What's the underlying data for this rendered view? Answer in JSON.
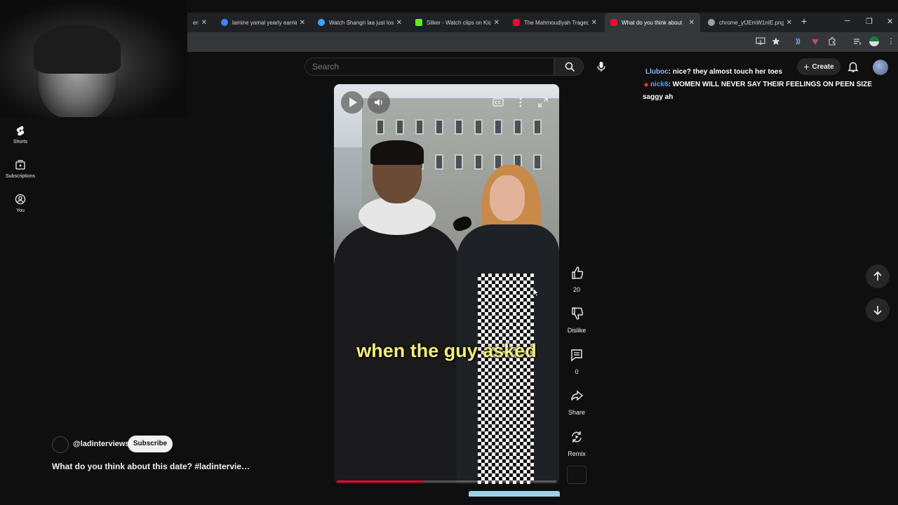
{
  "browser": {
    "tabs": [
      {
        "title": "ers I",
        "favicon_color": "#8a8a8a",
        "active": false
      },
      {
        "title": "lamine yamal yearly earnings",
        "favicon_color": "#4285f4",
        "active": false
      },
      {
        "title": "Watch Shangri laa just losing",
        "favicon_color": "#3ea6ff",
        "active": false
      },
      {
        "title": "Sliker - Watch clips on Kick",
        "favicon_color": "#53fc18",
        "active": false
      },
      {
        "title": "The Mahmoudiyah Tragedy",
        "favicon_color": "#ff0033",
        "active": false
      },
      {
        "title": "What do you think about",
        "favicon_color": "#ff0033",
        "active": true
      },
      {
        "title": "chrome_yfJEmW1nIE.png",
        "favicon_color": "#9aa0a6",
        "active": false
      }
    ],
    "new_tab_label": "+",
    "window_controls": {
      "minimize": "─",
      "restore": "❐",
      "close": "✕"
    }
  },
  "youtube": {
    "search": {
      "placeholder": "Search"
    },
    "create_label": "Create",
    "nav": [
      {
        "label": "Shorts",
        "icon": "shorts-icon"
      },
      {
        "label": "Subscriptions",
        "icon": "subscriptions-icon"
      },
      {
        "label": "You",
        "icon": "you-icon"
      }
    ],
    "video": {
      "caption": "when the guy asked",
      "progress": 0.39
    },
    "actions": {
      "like_count": "20",
      "dislike_label": "Dislike",
      "comment_count": "0",
      "share_label": "Share",
      "remix_label": "Remix"
    },
    "channel": {
      "handle": "@ladinterviews",
      "subscribe_label": "Subscribe"
    },
    "video_title": "What do you think about this date? #ladintervie…"
  },
  "chat": [
    {
      "user": "Lluboc",
      "text": ": nice? they almost touch her toes"
    },
    {
      "user": "nick6",
      "text": ": WOMEN WILL NEVER SAY THEIR FEELINGS ON PEEN SIZE"
    },
    {
      "user": "",
      "text": "saggy ah"
    }
  ],
  "colors": {
    "accent": "#ff0033",
    "background": "#0f0f0f",
    "caption": "#f5ef7a",
    "chat_user": "#8fb4ff"
  }
}
